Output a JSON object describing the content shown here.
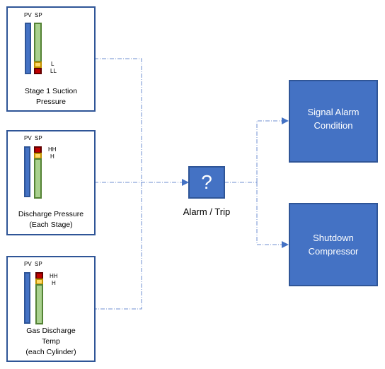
{
  "panels": [
    {
      "pv_label": "PV",
      "sp_label": "SP",
      "levels": [
        "L",
        "LL"
      ],
      "caption": [
        "Stage 1 Suction",
        "Pressure"
      ]
    },
    {
      "pv_label": "PV",
      "sp_label": "SP",
      "levels": [
        "HH",
        "H"
      ],
      "caption": [
        "Discharge Pressure",
        "(Each Stage)"
      ]
    },
    {
      "pv_label": "PV",
      "sp_label": "SP",
      "levels": [
        "HH",
        "H"
      ],
      "caption": [
        "Gas Discharge",
        "Temp",
        "(each Cylinder)"
      ]
    }
  ],
  "logic": {
    "symbol": "?",
    "label": "Alarm / Trip"
  },
  "outputs": [
    {
      "label": [
        "Signal Alarm",
        "Condition"
      ]
    },
    {
      "label": [
        "Shutdown",
        "Compressor"
      ]
    }
  ],
  "colors": {
    "block": "#4472c4",
    "border": "#2f5597",
    "connector": "#4472c4",
    "green": "#a9d18e",
    "yellow": "#ffd966",
    "red": "#c00000"
  }
}
